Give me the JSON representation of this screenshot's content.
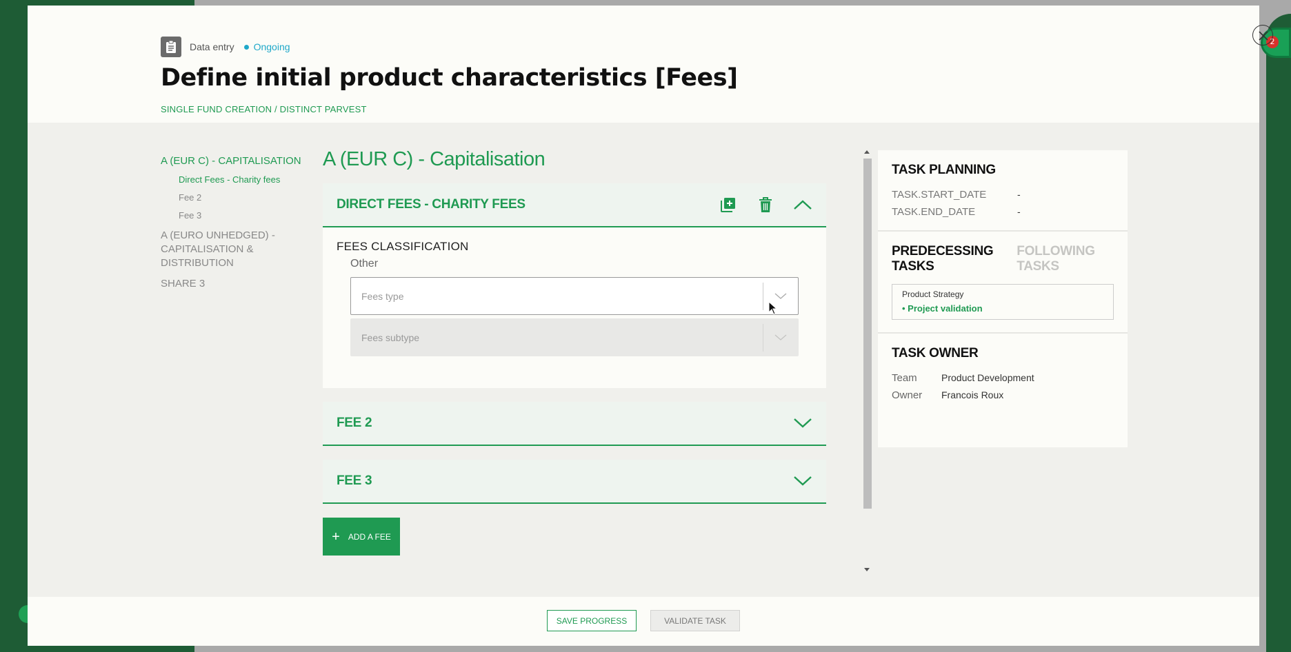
{
  "header": {
    "task_type": "Data entry",
    "status": "Ongoing",
    "title": "Define initial product characteristics [Fees]",
    "breadcrumb": "SINGLE FUND CREATION / DISTINCT PARVEST"
  },
  "nav": {
    "sections": [
      {
        "label": "A (EUR C) - CAPITALISATION",
        "active": true,
        "items": [
          {
            "label": "Direct Fees - Charity fees",
            "active": true
          },
          {
            "label": "Fee 2",
            "active": false
          },
          {
            "label": "Fee 3",
            "active": false
          }
        ]
      },
      {
        "label": "A (EURO UNHEDGED) - CAPITALISATION & DISTRIBUTION",
        "active": false,
        "items": []
      },
      {
        "label": "SHARE 3",
        "active": false,
        "items": []
      }
    ]
  },
  "main": {
    "section_title": "A (EUR C) - Capitalisation",
    "fees": [
      {
        "title": "DIRECT FEES - CHARITY FEES",
        "expanded": true,
        "classification_label": "FEES CLASSIFICATION",
        "classification_value": "Other",
        "type_placeholder": "Fees type",
        "subtype_placeholder": "Fees subtype"
      },
      {
        "title": "FEE 2",
        "expanded": false
      },
      {
        "title": "FEE 3",
        "expanded": false
      }
    ],
    "add_fee_label": "ADD A FEE"
  },
  "task_planning": {
    "heading": "TASK PLANNING",
    "start_label": "TASK.START_DATE",
    "start_value": "-",
    "end_label": "TASK.END_DATE",
    "end_value": "-"
  },
  "tasks": {
    "tab_predecessing": "PREDECESSING TASKS",
    "tab_following": "FOLLOWING TASKS",
    "group": "Product Strategy",
    "item": "Project validation"
  },
  "task_owner": {
    "heading": "TASK OWNER",
    "team_label": "Team",
    "team_value": "Product Development",
    "owner_label": "Owner",
    "owner_value": "Francois Roux"
  },
  "footer": {
    "save_label": "SAVE PROGRESS",
    "validate_label": "VALIDATE TASK"
  },
  "background": {
    "notification_count": "2"
  },
  "colors": {
    "accent": "#1f9a52",
    "status": "#1fa8c9",
    "sidebar_bg": "#1e5c35"
  }
}
